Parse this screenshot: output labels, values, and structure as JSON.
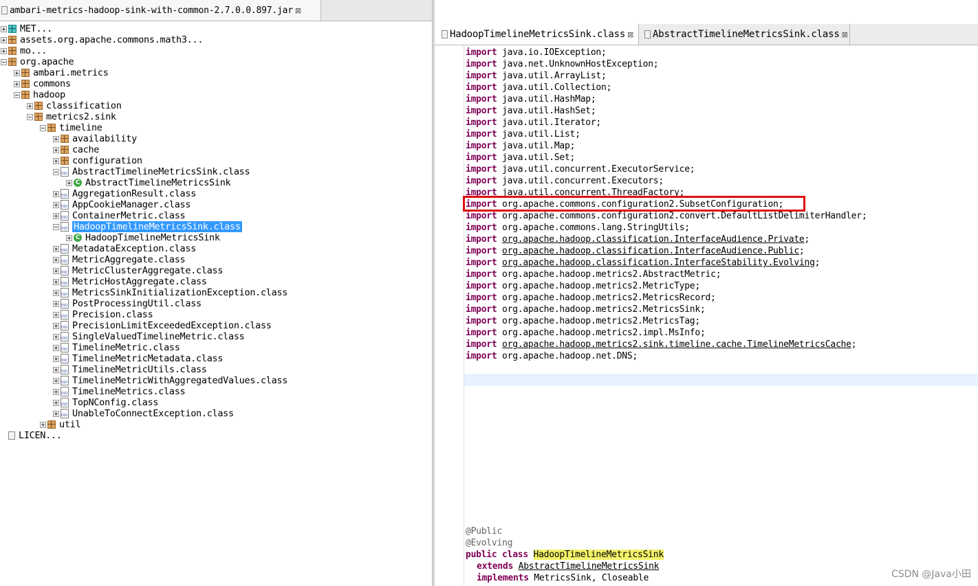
{
  "left_tab": {
    "title": "ambari-metrics-hadoop-sink-with-common-2.7.0.0.897.jar",
    "close": "⊠"
  },
  "tree": [
    {
      "label": "MET...",
      "icon": "package-teal-icon",
      "expander": "plus"
    },
    {
      "label": "assets.org.apache.commons.math3...",
      "icon": "package-icon",
      "expander": "plus"
    },
    {
      "label": "mo...",
      "icon": "package-icon",
      "expander": "plus"
    },
    {
      "label": "org.apache",
      "icon": "package-icon",
      "expander": "minus"
    },
    {
      "label": "ambari.metrics",
      "icon": "package-icon",
      "expander": "plus"
    },
    {
      "label": "commons",
      "icon": "package-icon",
      "expander": "plus"
    },
    {
      "label": "hadoop",
      "icon": "package-icon",
      "expander": "minus"
    },
    {
      "label": "classification",
      "icon": "package-icon",
      "expander": "plus"
    },
    {
      "label": "metrics2.sink",
      "icon": "package-icon",
      "expander": "minus"
    },
    {
      "label": "timeline",
      "icon": "package-icon",
      "expander": "minus"
    },
    {
      "label": "availability",
      "icon": "package-icon",
      "expander": "plus"
    },
    {
      "label": "cache",
      "icon": "package-icon",
      "expander": "plus"
    },
    {
      "label": "configuration",
      "icon": "package-icon",
      "expander": "plus"
    },
    {
      "label": "AbstractTimelineMetricsSink.class",
      "icon": "class-file-icon",
      "expander": "minus"
    },
    {
      "label": "AbstractTimelineMetricsSink",
      "icon": "class-type-icon",
      "expander": "plus"
    },
    {
      "label": "AggregationResult.class",
      "icon": "class-file-icon",
      "expander": "plus"
    },
    {
      "label": "AppCookieManager.class",
      "icon": "class-file-icon",
      "expander": "plus"
    },
    {
      "label": "ContainerMetric.class",
      "icon": "class-file-icon",
      "expander": "plus"
    },
    {
      "label": "HadoopTimelineMetricsSink.class",
      "icon": "class-file-icon",
      "expander": "minus",
      "selected": true
    },
    {
      "label": "HadoopTimelineMetricsSink",
      "icon": "class-type-icon",
      "expander": "plus"
    },
    {
      "label": "MetadataException.class",
      "icon": "class-file-icon",
      "expander": "plus"
    },
    {
      "label": "MetricAggregate.class",
      "icon": "class-file-icon",
      "expander": "plus"
    },
    {
      "label": "MetricClusterAggregate.class",
      "icon": "class-file-icon",
      "expander": "plus"
    },
    {
      "label": "MetricHostAggregate.class",
      "icon": "class-file-icon",
      "expander": "plus"
    },
    {
      "label": "MetricsSinkInitializationException.class",
      "icon": "class-file-icon",
      "expander": "plus"
    },
    {
      "label": "PostProcessingUtil.class",
      "icon": "class-file-icon",
      "expander": "plus"
    },
    {
      "label": "Precision.class",
      "icon": "class-file-icon",
      "expander": "plus"
    },
    {
      "label": "PrecisionLimitExceededException.class",
      "icon": "class-file-icon",
      "expander": "plus"
    },
    {
      "label": "SingleValuedTimelineMetric.class",
      "icon": "class-file-icon",
      "expander": "plus"
    },
    {
      "label": "TimelineMetric.class",
      "icon": "class-file-icon",
      "expander": "plus"
    },
    {
      "label": "TimelineMetricMetadata.class",
      "icon": "class-file-icon",
      "expander": "plus"
    },
    {
      "label": "TimelineMetricUtils.class",
      "icon": "class-file-icon",
      "expander": "plus"
    },
    {
      "label": "TimelineMetricWithAggregatedValues.class",
      "icon": "class-file-icon",
      "expander": "plus"
    },
    {
      "label": "TimelineMetrics.class",
      "icon": "class-file-icon",
      "expander": "plus"
    },
    {
      "label": "TopNConfig.class",
      "icon": "class-file-icon",
      "expander": "plus"
    },
    {
      "label": "UnableToConnectException.class",
      "icon": "class-file-icon",
      "expander": "plus"
    },
    {
      "label": "util",
      "icon": "package-icon",
      "expander": "plus"
    },
    {
      "label": "LICEN...",
      "icon": "text-file-icon",
      "expander": "none"
    }
  ],
  "editor_tabs": [
    {
      "label": "HadoopTimelineMetricsSink.class",
      "close": "⊠",
      "active": true
    },
    {
      "label": "AbstractTimelineMetricsSink.class",
      "close": "⊠",
      "active": false
    }
  ],
  "code": {
    "import_keyword": "import",
    "imports": [
      {
        "path": "java.io.IOException;",
        "underline": false
      },
      {
        "path": "java.net.UnknownHostException;",
        "underline": false
      },
      {
        "path": "java.util.ArrayList;",
        "underline": false
      },
      {
        "path": "java.util.Collection;",
        "underline": false
      },
      {
        "path": "java.util.HashMap;",
        "underline": false
      },
      {
        "path": "java.util.HashSet;",
        "underline": false
      },
      {
        "path": "java.util.Iterator;",
        "underline": false
      },
      {
        "path": "java.util.List;",
        "underline": false
      },
      {
        "path": "java.util.Map;",
        "underline": false
      },
      {
        "path": "java.util.Set;",
        "underline": false
      },
      {
        "path": "java.util.concurrent.ExecutorService;",
        "underline": false
      },
      {
        "path": "java.util.concurrent.Executors;",
        "underline": false
      },
      {
        "path": "java.util.concurrent.ThreadFactory;",
        "underline": false
      },
      {
        "path": "org.apache.commons.configuration2.SubsetConfiguration;",
        "underline": false,
        "highlighted": true
      },
      {
        "path": "org.apache.commons.configuration2.convert.DefaultListDelimiterHandler;",
        "underline": false
      },
      {
        "path": "org.apache.commons.lang.StringUtils;",
        "underline": false
      },
      {
        "path": "org.apache.hadoop.classification.InterfaceAudience.Private",
        "suffix": ";",
        "underline": true
      },
      {
        "path": "org.apache.hadoop.classification.InterfaceAudience.Public",
        "suffix": ";",
        "underline": true
      },
      {
        "path": "org.apache.hadoop.classification.InterfaceStability.Evolving",
        "suffix": ";",
        "underline": true
      },
      {
        "path": "org.apache.hadoop.metrics2.AbstractMetric;",
        "underline": false
      },
      {
        "path": "org.apache.hadoop.metrics2.MetricType;",
        "underline": false
      },
      {
        "path": "org.apache.hadoop.metrics2.MetricsRecord;",
        "underline": false
      },
      {
        "path": "org.apache.hadoop.metrics2.MetricsSink;",
        "underline": false
      },
      {
        "path": "org.apache.hadoop.metrics2.MetricsTag;",
        "underline": false
      },
      {
        "path": "org.apache.hadoop.metrics2.impl.MsInfo;",
        "underline": false
      },
      {
        "path": "org.apache.hadoop.metrics2.sink.timeline.cache.TimelineMetricsCache",
        "suffix": ";",
        "underline": true
      },
      {
        "path": "org.apache.hadoop.net.DNS;",
        "underline": false
      }
    ],
    "annotations": [
      "@Public",
      "@Evolving"
    ],
    "class_decl": {
      "modifiers": "public class",
      "name": "HadoopTimelineMetricsSink",
      "extends_kw": "extends",
      "extends_name": "AbstractTimelineMetricsSink",
      "implements_kw": "implements",
      "implements_names": "MetricsSink, Closeable"
    }
  },
  "watermark": "CSDN @Java小田",
  "colors": {
    "keyword": "#7f0055",
    "selection": "#3399ff",
    "highlight_box": "#e01010",
    "name_highlight": "#f2f26a"
  }
}
